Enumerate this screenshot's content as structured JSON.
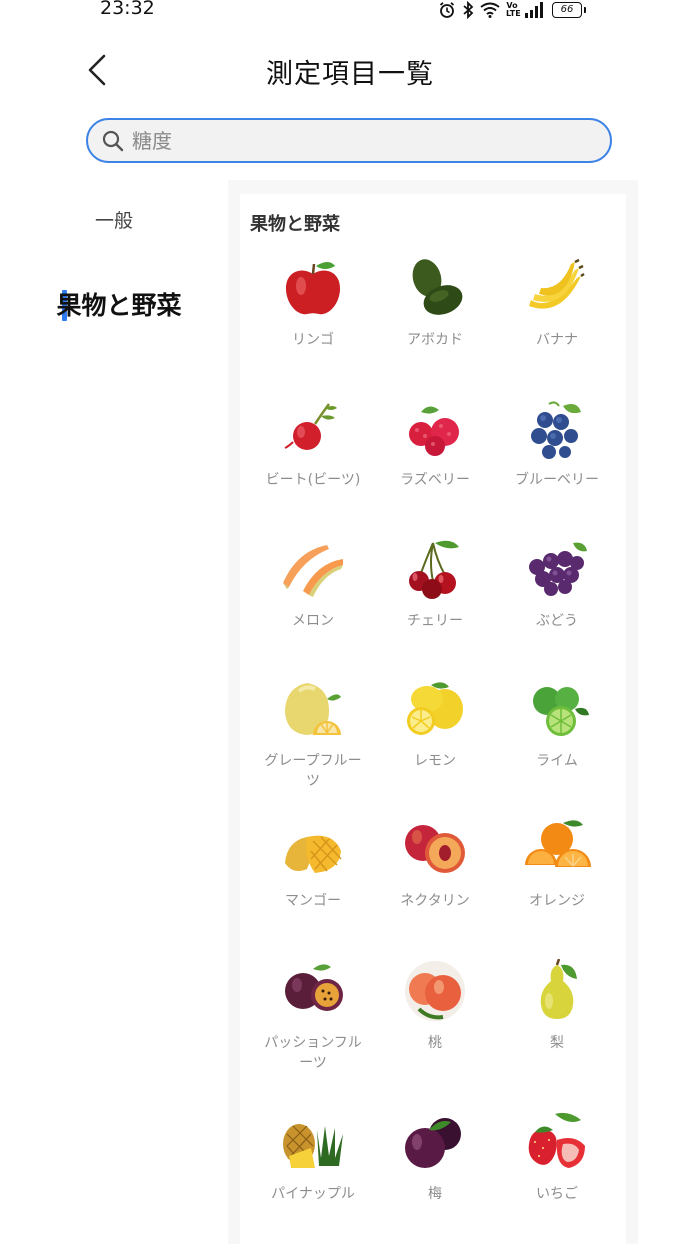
{
  "status_bar": {
    "time": "23:32",
    "battery": "66",
    "volte": "Vo LTE"
  },
  "header": {
    "title": "測定項目一覧"
  },
  "search": {
    "placeholder": "糖度",
    "value": ""
  },
  "sidebar": {
    "items": [
      {
        "label": "一般",
        "active": false
      },
      {
        "label": "果物と野菜",
        "active": true
      }
    ],
    "accent_color": "#2f7bf0"
  },
  "main": {
    "section_title": "果物と野菜",
    "items": [
      {
        "label": "リンゴ",
        "icon": "apple-icon"
      },
      {
        "label": "アボカド",
        "icon": "avocado-icon"
      },
      {
        "label": "バナナ",
        "icon": "banana-icon"
      },
      {
        "label": "ビート(ビーツ)",
        "icon": "beet-icon"
      },
      {
        "label": "ラズベリー",
        "icon": "raspberry-icon"
      },
      {
        "label": "ブルーベリー",
        "icon": "blueberry-icon"
      },
      {
        "label": "メロン",
        "icon": "melon-icon"
      },
      {
        "label": "チェリー",
        "icon": "cherry-icon"
      },
      {
        "label": "ぶどう",
        "icon": "grape-icon"
      },
      {
        "label": "グレープフルーツ",
        "icon": "grapefruit-icon"
      },
      {
        "label": "レモン",
        "icon": "lemon-icon"
      },
      {
        "label": "ライム",
        "icon": "lime-icon"
      },
      {
        "label": "マンゴー",
        "icon": "mango-icon"
      },
      {
        "label": "ネクタリン",
        "icon": "nectarine-icon"
      },
      {
        "label": "オレンジ",
        "icon": "orange-icon"
      },
      {
        "label": "パッションフルーツ",
        "icon": "passion-fruit-icon"
      },
      {
        "label": "桃",
        "icon": "peach-icon"
      },
      {
        "label": "梨",
        "icon": "pear-icon"
      },
      {
        "label": "パイナップル",
        "icon": "pineapple-icon"
      },
      {
        "label": "梅",
        "icon": "plum-icon"
      },
      {
        "label": "いちご",
        "icon": "strawberry-icon"
      }
    ]
  }
}
